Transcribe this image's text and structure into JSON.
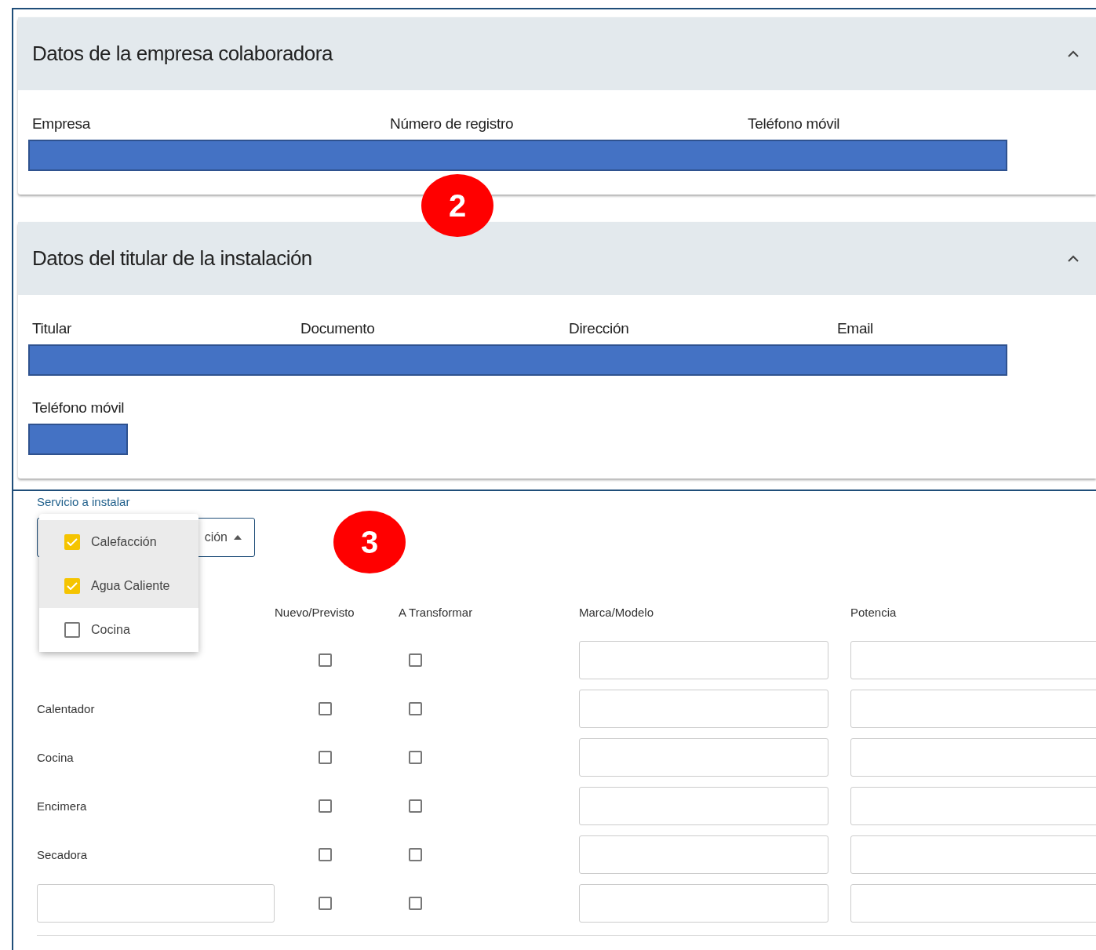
{
  "sections": [
    {
      "title": "Datos de la empresa colaboradora",
      "expanded": true,
      "fields": [
        {
          "label": "Empresa"
        },
        {
          "label": "Número de registro"
        },
        {
          "label": "Teléfono móvil"
        }
      ]
    },
    {
      "title": "Datos del titular de la instalación",
      "expanded": true,
      "fields": [
        {
          "label": "Titular"
        },
        {
          "label": "Documento"
        },
        {
          "label": "Dirección"
        },
        {
          "label": "Email"
        }
      ],
      "extra_fields": [
        {
          "label": "Teléfono móvil"
        }
      ]
    }
  ],
  "service": {
    "label": "Servicio a instalar",
    "value": "ción",
    "open": true,
    "options": [
      {
        "label": "Calefacción",
        "checked": true
      },
      {
        "label": "Agua Caliente",
        "checked": true
      },
      {
        "label": "Cocina",
        "checked": false
      }
    ]
  },
  "table": {
    "columns": [
      "Nuevo/Previsto",
      "A Transformar",
      "Marca/Modelo",
      "Potencia"
    ],
    "rows": [
      {
        "kind": "fixed",
        "nuevo": false,
        "transformar": false
      },
      {
        "kind": "fixed",
        "label": "Calentador",
        "nuevo": false,
        "transformar": false
      },
      {
        "kind": "fixed",
        "label": "Cocina",
        "nuevo": false,
        "transformar": false
      },
      {
        "kind": "fixed",
        "label": "Encimera",
        "nuevo": false,
        "transformar": false
      },
      {
        "kind": "fixed",
        "label": "Secadora",
        "nuevo": false,
        "transformar": false
      },
      {
        "kind": "custom",
        "nuevo": false,
        "transformar": false
      }
    ]
  },
  "badges": [
    "2",
    "3"
  ]
}
